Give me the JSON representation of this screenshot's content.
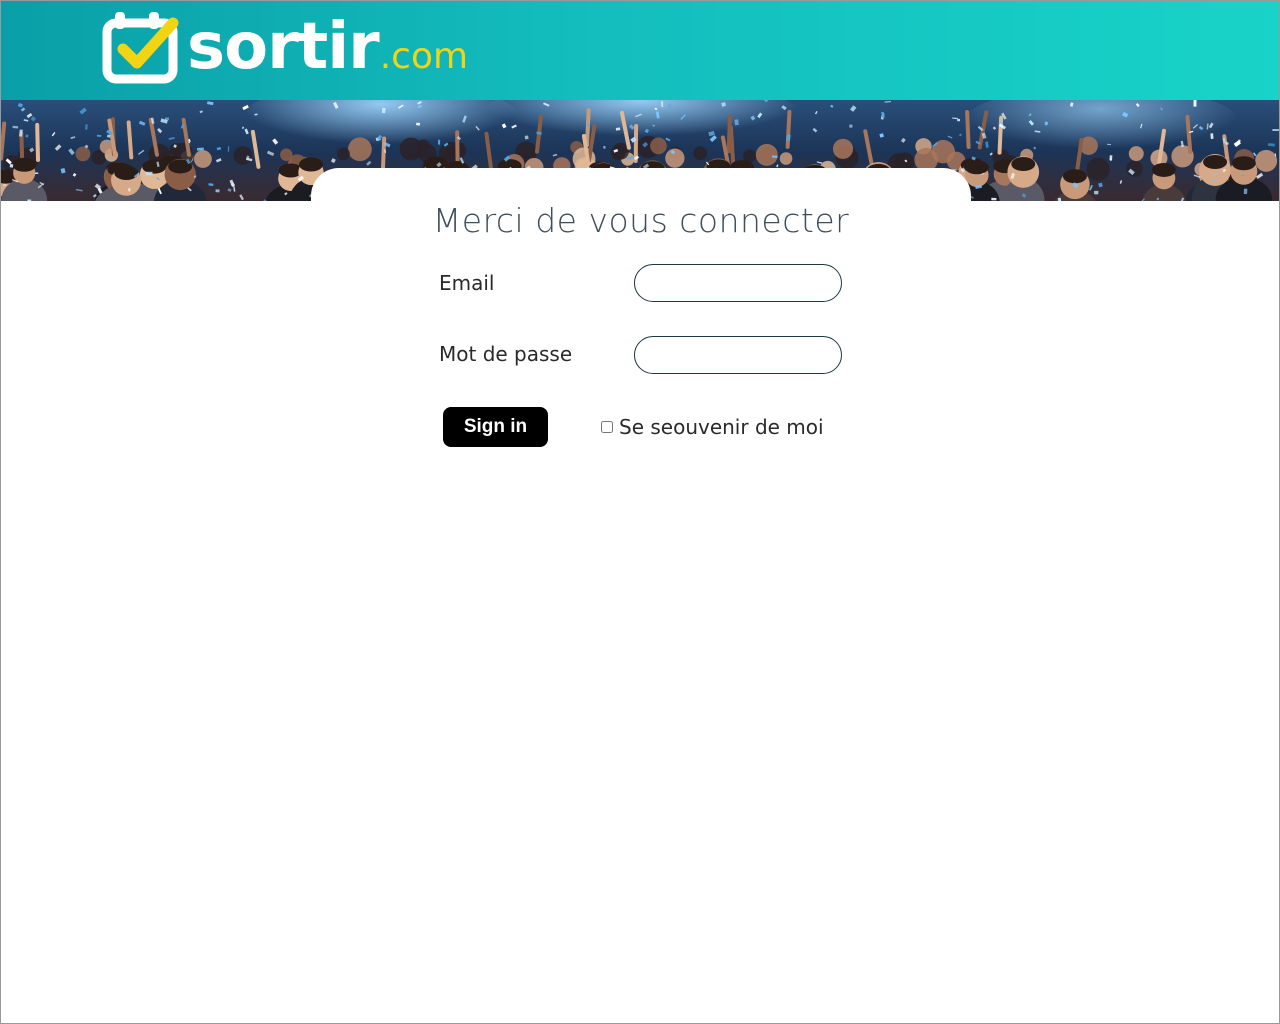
{
  "brand": {
    "name": "sortir",
    "suffix": ".com",
    "colors": {
      "header_gradient_start": "#0a9fa8",
      "header_gradient_end": "#18d3c8",
      "logo_accent": "#f1d414",
      "logo_text": "#ffffff"
    },
    "icon": "calendar-check-icon"
  },
  "banner": {
    "image": "concert-crowd-confetti-photo"
  },
  "login": {
    "title": "Merci de vous connecter",
    "email_label": "Email",
    "email_value": "",
    "password_label": "Mot de passe",
    "password_value": "",
    "submit_label": "Sign in",
    "remember_label": "Se seouvenir de moi",
    "remember_checked": false
  }
}
